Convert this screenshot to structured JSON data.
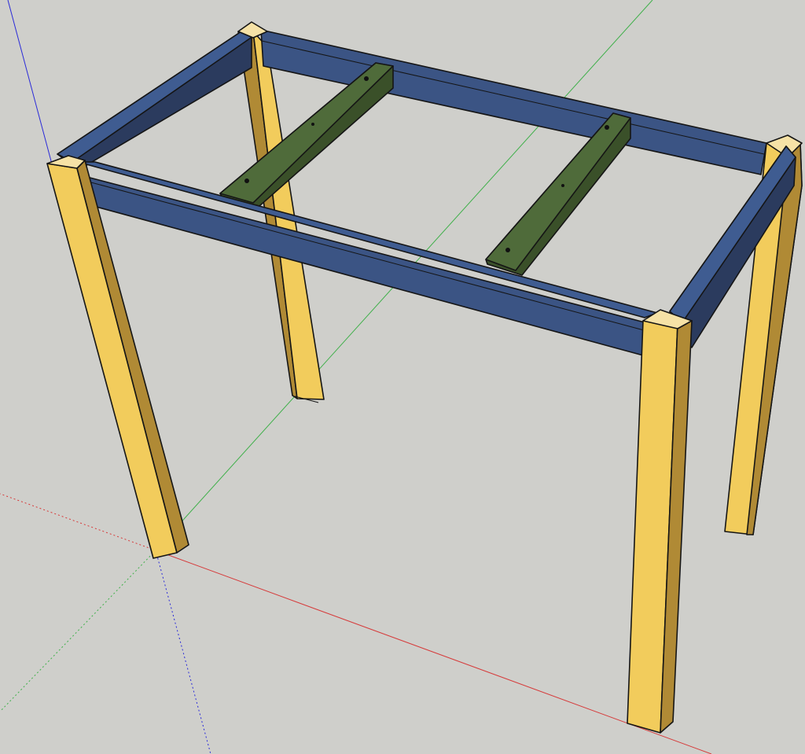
{
  "app": {
    "name": ""
  },
  "viewport": {
    "background": "#cfcfcb",
    "axes": {
      "red": "#d63a3a",
      "green": "#3fb04a",
      "blue": "#2a2ad8"
    }
  },
  "model": {
    "parts": [
      {
        "name": "leg",
        "count": 4,
        "colors": {
          "top": "#f6e2a6",
          "front": "#f2cc5c",
          "side": "#b08a35"
        }
      },
      {
        "name": "apron-rail",
        "count": 4,
        "colors": {
          "face": "#3b5484",
          "inner": "#2b3b5e",
          "top": "#3f5c91"
        }
      },
      {
        "name": "stretcher",
        "count": 2,
        "colors": {
          "top": "#4f6b3a",
          "side": "#3a5029"
        }
      }
    ]
  }
}
